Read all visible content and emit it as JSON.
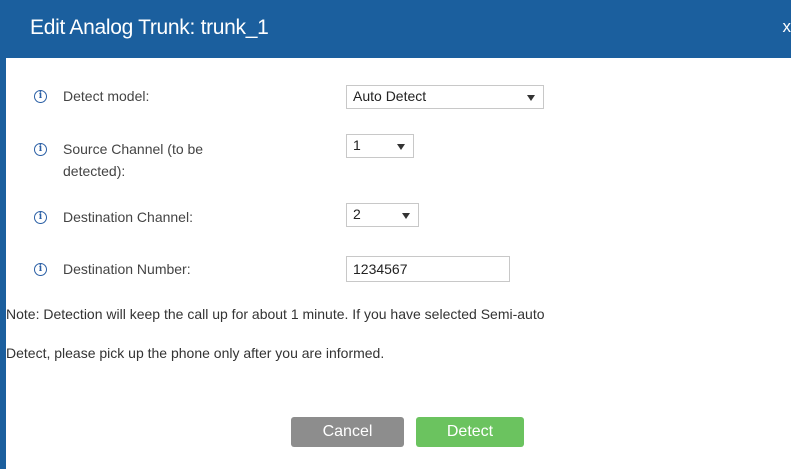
{
  "dialog": {
    "title": "Edit Analog Trunk: trunk_1",
    "close_label": "x"
  },
  "fields": {
    "detect_model": {
      "label": "Detect model:",
      "value": "Auto Detect"
    },
    "source_channel": {
      "label_line1": "Source Channel (to be",
      "label_line2": "detected):",
      "value": "1"
    },
    "destination_channel": {
      "label": "Destination Channel:",
      "value": "2"
    },
    "destination_number": {
      "label": "Destination Number:",
      "value": "1234567"
    }
  },
  "note": {
    "line1": "Note: Detection will keep the call up for about 1 minute. If you have selected Semi-auto",
    "line2": "Detect, please pick up the phone only after you are informed."
  },
  "buttons": {
    "cancel_label": "Cancel",
    "detect_label": "Detect"
  },
  "colors": {
    "titlebar": "#1b5f9e",
    "cancel_button": "#8d8d8d",
    "detect_button": "#6bc35f",
    "info_icon": "#2a5fa5"
  },
  "icons": {
    "info": "info-circle-icon",
    "dropdown": "chevron-down-icon"
  }
}
